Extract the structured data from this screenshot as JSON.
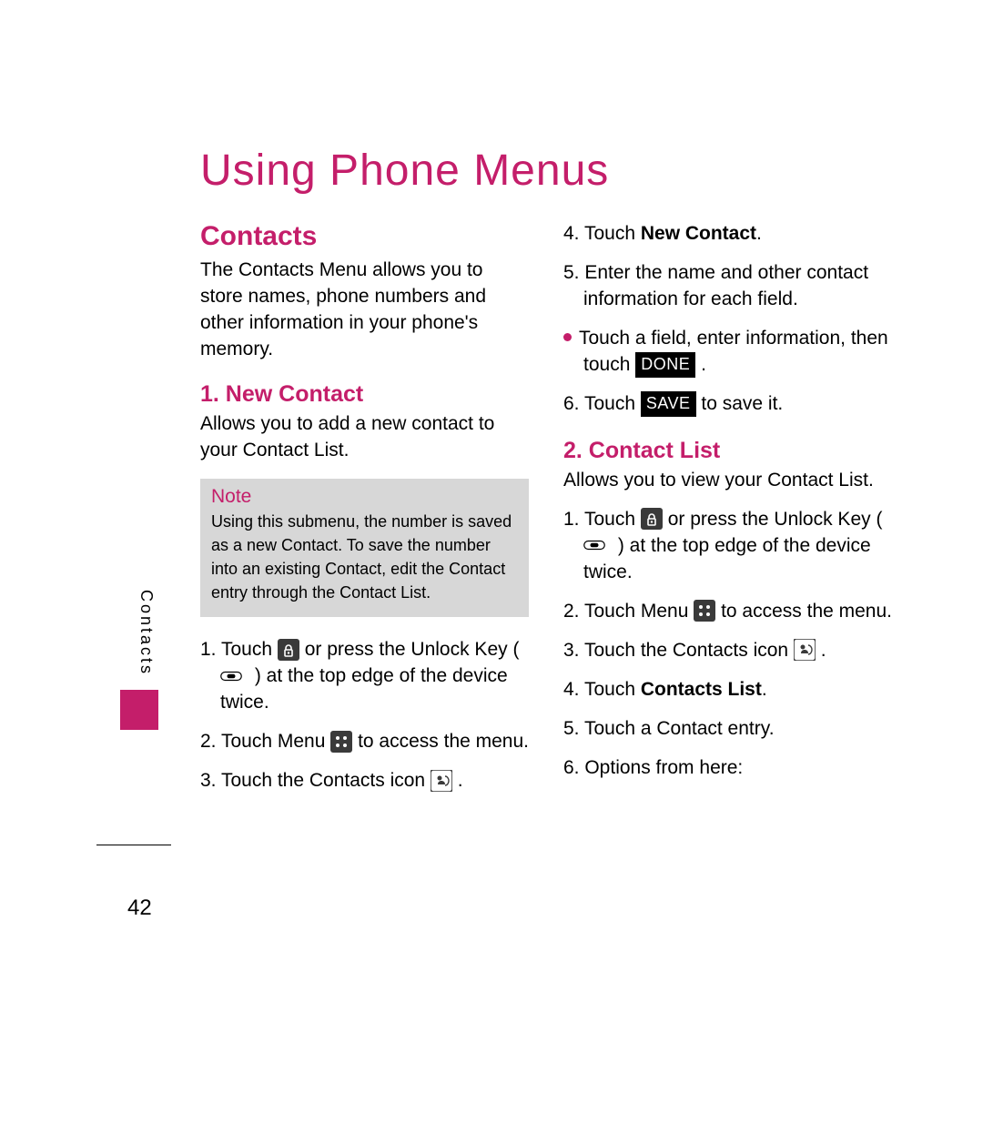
{
  "page": {
    "title": "Using Phone Menus",
    "sidebar_label": "Contacts",
    "page_number": "42"
  },
  "icons": {
    "lock": "lock-icon",
    "unlock_key": "unlock-key-icon",
    "menu_grid": "menu-grid-icon",
    "contacts": "contacts-icon"
  },
  "badges": {
    "done": "DONE",
    "save": "SAVE"
  },
  "left": {
    "section_heading": "Contacts",
    "intro": "The Contacts Menu allows you to store names, phone numbers and other information in your phone's memory.",
    "sub_heading": "1. New Contact",
    "sub_intro": "Allows you to add a new contact to your Contact List.",
    "note_label": "Note",
    "note_body": "Using this submenu, the number is saved as a new Contact. To save the number into an existing Contact, edit the Contact entry through the Contact List.",
    "s1_a": "1. Touch ",
    "s1_b": " or press the Unlock Key ( ",
    "s1_c": " ) at the top edge of the device twice.",
    "s2_a": "2. Touch Menu ",
    "s2_b": "  to access the menu.",
    "s3_a": "3. Touch the Contacts icon ",
    "s3_b": " ."
  },
  "right": {
    "s4_a": "4. Touch ",
    "s4_bold": "New Contact",
    "s4_b": ".",
    "s5": "5. Enter the name and other contact information for each field.",
    "b1_a": "Touch a field, enter information, then touch ",
    "b1_b": " .",
    "s6_a": "6. Touch ",
    "s6_b": "  to save it.",
    "sub_heading": "2. Contact List",
    "sub_intro": "Allows you to view your Contact List.",
    "s1_a": "1. Touch ",
    "s1_b": " or press the Unlock Key ( ",
    "s1_c": " ) at the top edge of the device twice.",
    "s2_a": "2. Touch Menu ",
    "s2_b": "  to access the menu.",
    "s3_a": "3. Touch the Contacts icon ",
    "s3_b": " .",
    "s4b_a": "4. Touch ",
    "s4b_bold": "Contacts List",
    "s4b_b": ".",
    "s5b": "5. Touch a Contact entry.",
    "s6b": "6.  Options from here:"
  }
}
